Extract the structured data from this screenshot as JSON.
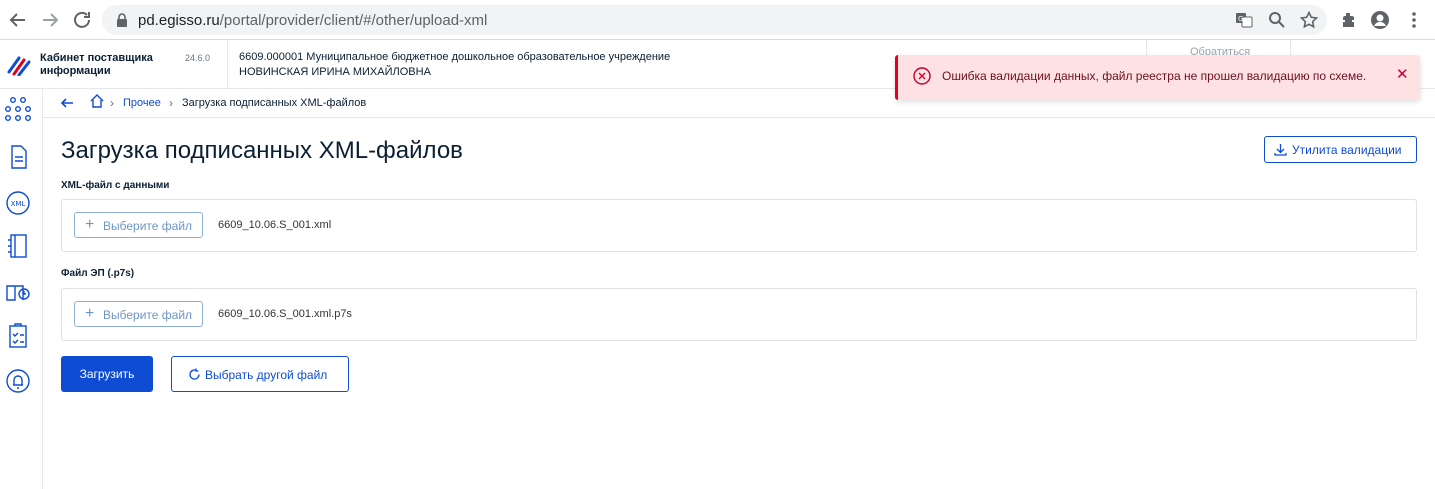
{
  "browser": {
    "url_host": "pd.egisso.ru",
    "url_path": "/portal/provider/client/#/other/upload-xml"
  },
  "header": {
    "cabinet_title": "Кабинет поставщика информации",
    "version": "24.6.0",
    "org_name": "6609.000001 Муниципальное бюджетное дошкольное образовательное учреждение",
    "user_name": "НОВИНСКАЯ ИРИНА МИХАЙЛОВНА",
    "faded_link": "Обратиться"
  },
  "breadcrumb": {
    "link": "Прочее",
    "current": "Загрузка подписанных XML-файлов"
  },
  "main": {
    "title": "Загрузка подписанных XML-файлов",
    "validator_button": "Утилита валидации",
    "xml_field": {
      "label": "XML-файл с данными",
      "choose_label": "Выберите файл",
      "file_name": "6609_10.06.S_001.xml"
    },
    "sig_field": {
      "label": "Файл ЭП (.p7s)",
      "choose_label": "Выберите файл",
      "file_name": "6609_10.06.S_001.xml.p7s"
    },
    "upload_button": "Загрузить",
    "other_file_button": "Выбрать другой файл"
  },
  "toast": {
    "message": "Ошибка валидации данных, файл реестра не прошел валидацию по схеме.",
    "close": "✕"
  },
  "sidebar": {
    "xml_icon_text": "XML"
  },
  "colors": {
    "primary": "#0d4cd3",
    "error_bg": "#fde1e3",
    "error_accent": "#e1001e"
  }
}
